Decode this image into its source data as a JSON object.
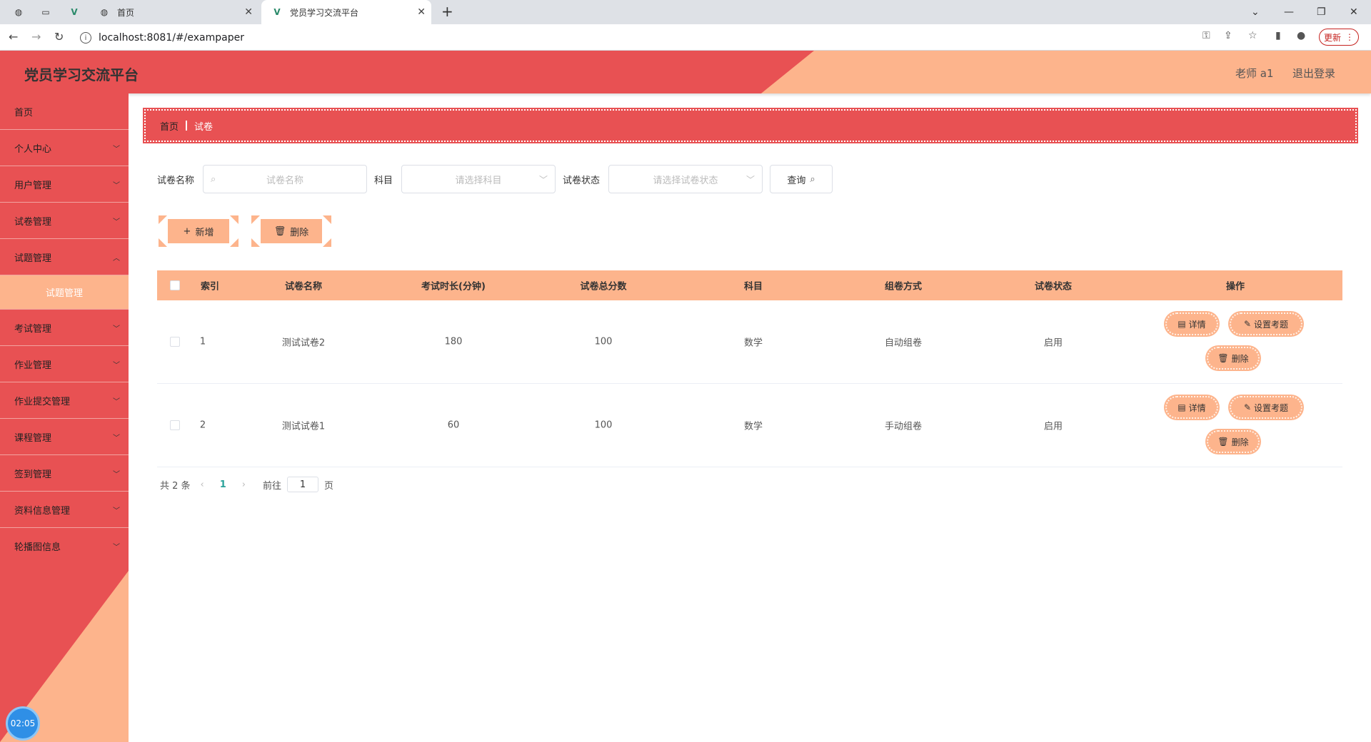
{
  "browser": {
    "tabs": [
      {
        "label": ""
      },
      {
        "label": ""
      },
      {
        "label": ""
      },
      {
        "label": "首页"
      },
      {
        "label": "党员学习交流平台"
      }
    ],
    "url": "localhost:8081/#/exampaper",
    "update_label": "更新"
  },
  "header": {
    "title": "党员学习交流平台",
    "user": "老师 a1",
    "logout": "退出登录"
  },
  "sidebar": {
    "items": [
      {
        "label": "首页"
      },
      {
        "label": "个人中心"
      },
      {
        "label": "用户管理"
      },
      {
        "label": "试卷管理"
      },
      {
        "label": "试题管理"
      },
      {
        "label": "考试管理"
      },
      {
        "label": "作业管理"
      },
      {
        "label": "作业提交管理"
      },
      {
        "label": "课程管理"
      },
      {
        "label": "签到管理"
      },
      {
        "label": "资料信息管理"
      },
      {
        "label": "轮播图信息"
      }
    ],
    "submenu_label": "试题管理",
    "clock": "02:05"
  },
  "breadcrumb": {
    "home": "首页",
    "current": "试卷"
  },
  "search": {
    "name_label": "试卷名称",
    "name_placeholder": "试卷名称",
    "subject_label": "科目",
    "subject_placeholder": "请选择科目",
    "status_label": "试卷状态",
    "status_placeholder": "请选择试卷状态",
    "query_label": "查询"
  },
  "actions": {
    "add_label": "新增",
    "delete_label": "删除"
  },
  "table": {
    "columns": [
      "索引",
      "试卷名称",
      "考试时长(分钟)",
      "试卷总分数",
      "科目",
      "组卷方式",
      "试卷状态",
      "操作"
    ],
    "rows": [
      {
        "index": "1",
        "name": "测试试卷2",
        "duration": "180",
        "score": "100",
        "subject": "数学",
        "method": "自动组卷",
        "status": "启用"
      },
      {
        "index": "2",
        "name": "测试试卷1",
        "duration": "60",
        "score": "100",
        "subject": "数学",
        "method": "手动组卷",
        "status": "启用"
      }
    ],
    "row_actions": {
      "detail": "详情",
      "setup": "设置考题",
      "delete": "删除"
    }
  },
  "pagination": {
    "total": "共 2 条",
    "current_page": "1",
    "goto_label": "前往",
    "goto_value": "1",
    "page_suffix": "页"
  },
  "colors": {
    "primary_red": "#e85153",
    "accent_peach": "#fdb48c",
    "page_link": "#2aa29a"
  }
}
